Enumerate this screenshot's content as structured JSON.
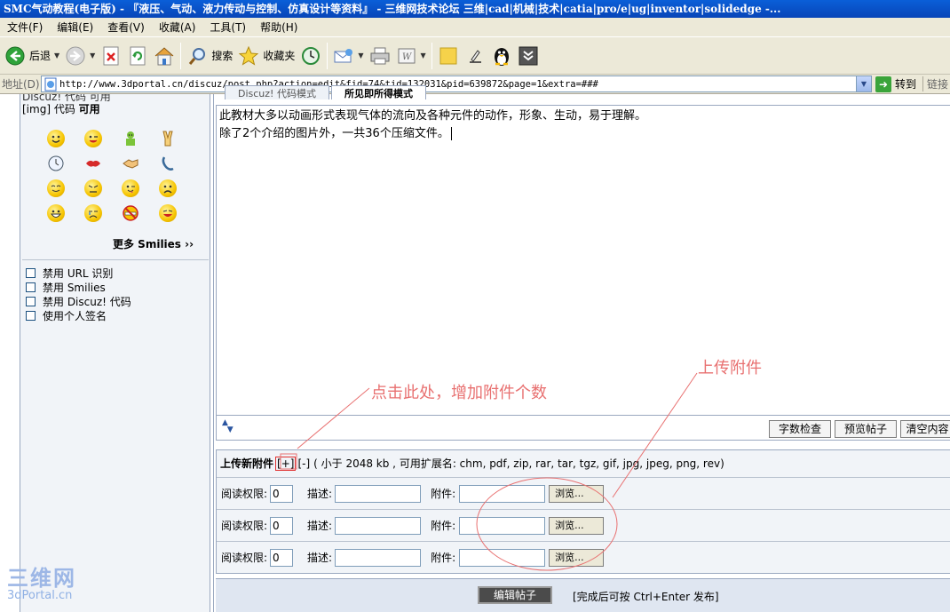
{
  "window": {
    "title": "SMC气动教程(电子版) - 『液压、气动、液力传动与控制、仿真设计等资料』 - 三维网技术论坛 三维|cad|机械|技术|catia|pro/e|ug|inventor|solidedge -..."
  },
  "menubar": {
    "items": [
      "文件(F)",
      "编辑(E)",
      "查看(V)",
      "收藏(A)",
      "工具(T)",
      "帮助(H)"
    ]
  },
  "toolbar": {
    "back_label": "后退",
    "search_label": "搜索",
    "favorites_label": "收藏夹"
  },
  "addressbar": {
    "label": "地址(D)",
    "url": "http://www.3dportal.cn/discuz/post.php?action=edit&fid=74&tid=132031&pid=639872&page=1&extra=###",
    "go_label": "转到",
    "links_label": "链接"
  },
  "sidebar": {
    "cut_text": "Discuz! 代码 可用",
    "img_code_prefix": "[img] 代码",
    "img_code_status": "可用",
    "more_smilies": "更多 Smilies ››",
    "options": [
      "禁用 URL 识别",
      "禁用 Smilies",
      "禁用 Discuz! 代码",
      "使用个人签名"
    ]
  },
  "editor": {
    "tabs": [
      "Discuz! 代码模式",
      "所见即所得模式"
    ],
    "lines": [
      "此教材大多以动画形式表现气体的流向及各种元件的动作，形象、生动，易于理解。",
      "除了2个介绍的图片外，一共36个压缩文件。"
    ],
    "buttons": [
      "字数检查",
      "预览帖子",
      "清空内容"
    ]
  },
  "upload": {
    "title": "上传新附件",
    "add": "[+]",
    "remove": "[-]",
    "hint": "( 小于 2048 kb , 可用扩展名: chm, pdf, zip, rar, tar, tgz, gif, jpg, jpeg, png, rev)",
    "read_label": "阅读权限:",
    "read_value": "0",
    "desc_label": "描述:",
    "attach_label": "附件:",
    "browse_label": "浏览...",
    "rows": 3
  },
  "submit": {
    "button": "编辑帖子",
    "hint": "[完成后可按 Ctrl+Enter 发布]"
  },
  "annotations": {
    "click_here": "点击此处，增加附件个数",
    "upload_attachment": "上传附件",
    "color": "#e87070"
  },
  "watermark": {
    "top": "三维网",
    "bottom": "3dPortal.cn"
  }
}
